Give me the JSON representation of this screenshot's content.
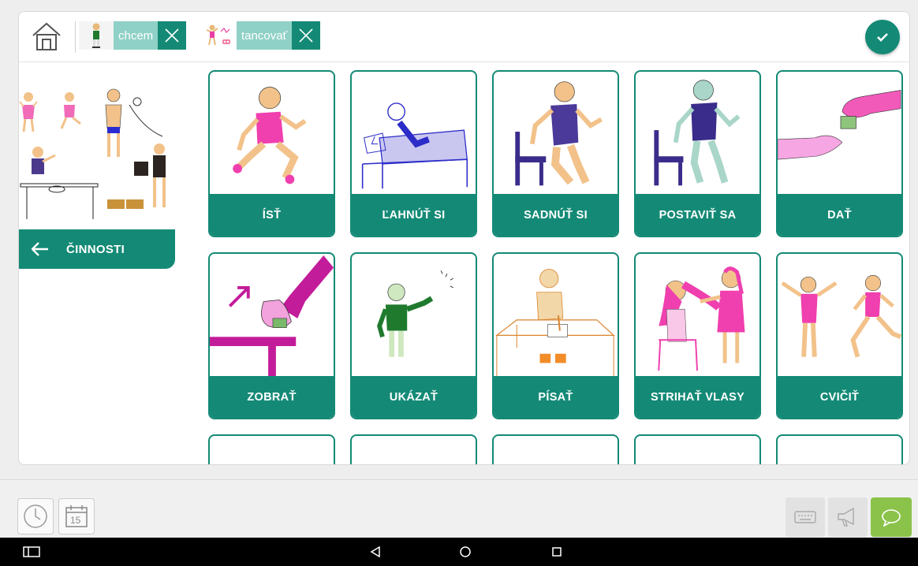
{
  "topbar": {
    "home_icon": "home-icon",
    "sentence": [
      {
        "label": "chcem",
        "icon": "boy-wanting-icon"
      },
      {
        "label": "tancovať",
        "icon": "dancing-icon"
      }
    ],
    "confirm_icon": "checkmark-icon"
  },
  "category": {
    "name": "ČINNOSTI",
    "back_icon": "arrow-left-icon"
  },
  "cards": [
    {
      "label": "ÍSŤ"
    },
    {
      "label": "ĽAHNÚŤ SI"
    },
    {
      "label": "SADNÚŤ SI"
    },
    {
      "label": "POSTAVIŤ SA"
    },
    {
      "label": "DAŤ"
    },
    {
      "label": "ZOBRAŤ"
    },
    {
      "label": "UKÁZAŤ"
    },
    {
      "label": "PÍSAŤ"
    },
    {
      "label": "STRIHAŤ VLASY"
    },
    {
      "label": "CVIČIŤ"
    }
  ],
  "bottombar": {
    "left": [
      "clock-icon",
      "calendar-icon"
    ],
    "calendar_day": "15",
    "right": [
      "keyboard-icon",
      "megaphone-icon",
      "speech-bubble-icon"
    ],
    "accent": "#8bc34a"
  },
  "navbar": [
    "recent-apps-icon",
    "back-icon",
    "home-circle-icon",
    "overview-icon"
  ],
  "colors": {
    "primary": "#148a76",
    "chip_light": "#8fd1c6"
  }
}
